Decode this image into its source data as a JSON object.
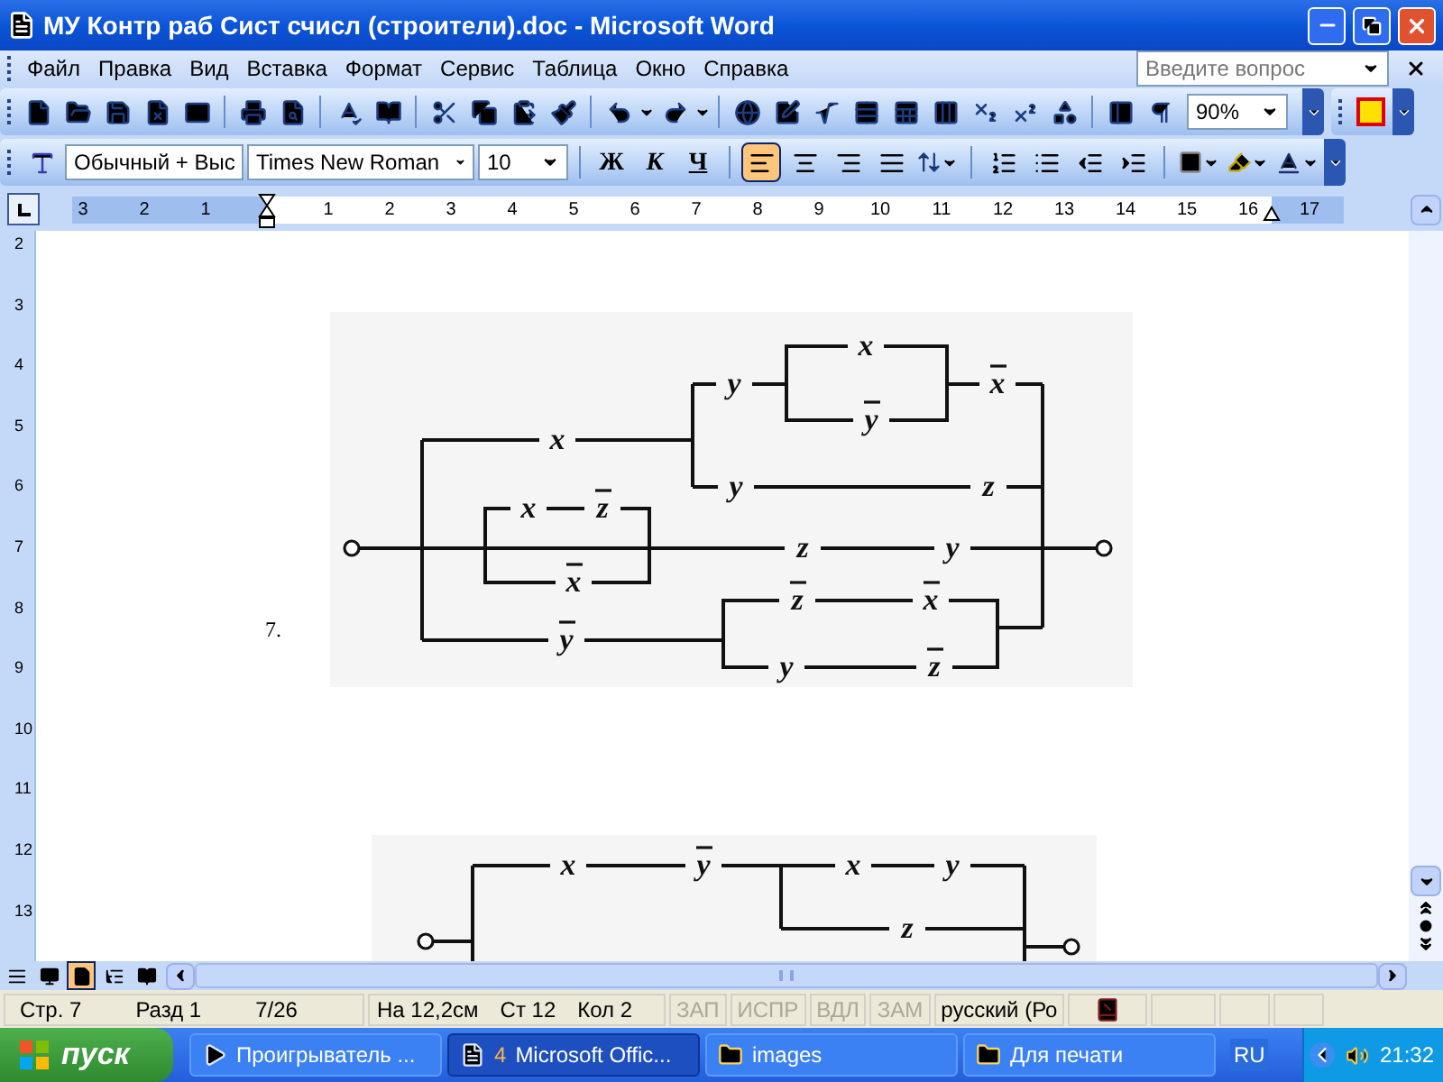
{
  "window": {
    "title": "МУ Контр раб Сист счисл (строители).doc - Microsoft Word"
  },
  "menu": [
    "Файл",
    "Правка",
    "Вид",
    "Вставка",
    "Формат",
    "Сервис",
    "Таблица",
    "Окно",
    "Справка"
  ],
  "help_search": {
    "placeholder": "Введите вопрос"
  },
  "zoom": "90%",
  "formatting": {
    "style": "Обычный + Выс",
    "font": "Times New Roman",
    "size": "10",
    "buttons": [
      "Ж",
      "К",
      "Ч"
    ],
    "alignment": [
      {
        "kind": "left",
        "selected": true
      },
      {
        "kind": "center",
        "selected": false
      },
      {
        "kind": "right",
        "selected": false
      },
      {
        "kind": "justify",
        "selected": false
      }
    ]
  },
  "ruler": {
    "left_numbers": [
      "3",
      "2",
      "1"
    ],
    "right_numbers": [
      "1",
      "2",
      "3",
      "4",
      "5",
      "6",
      "7",
      "8",
      "9",
      "10",
      "11",
      "12",
      "13",
      "14",
      "15",
      "16",
      "17"
    ]
  },
  "vertical_ruler": [
    "2",
    "3",
    "4",
    "5",
    "6",
    "7",
    "8",
    "9",
    "10",
    "11",
    "12",
    "13"
  ],
  "document": {
    "figures": [
      {
        "number": "7.",
        "labels": [
          {
            "text": "x",
            "negated": false
          },
          {
            "text": "y",
            "negated": false
          },
          {
            "text": "x",
            "negated": true
          },
          {
            "text": "y",
            "negated": true
          },
          {
            "text": "x",
            "negated": false
          },
          {
            "text": "y",
            "negated": false
          },
          {
            "text": "z",
            "negated": false
          },
          {
            "text": "x",
            "negated": false
          },
          {
            "text": "z",
            "negated": true
          },
          {
            "text": "z",
            "negated": false
          },
          {
            "text": "y",
            "negated": false
          },
          {
            "text": "x",
            "negated": true
          },
          {
            "text": "z",
            "negated": true
          },
          {
            "text": "x",
            "negated": true
          },
          {
            "text": "y",
            "negated": true
          },
          {
            "text": "y",
            "negated": false
          },
          {
            "text": "z",
            "negated": true
          }
        ]
      },
      {
        "labels": [
          {
            "text": "x",
            "negated": false
          },
          {
            "text": "y",
            "negated": true
          },
          {
            "text": "x",
            "negated": false
          },
          {
            "text": "y",
            "negated": false
          },
          {
            "text": "z",
            "negated": false
          }
        ]
      }
    ]
  },
  "view_modes": [
    {
      "kind": "normal",
      "selected": false
    },
    {
      "kind": "web",
      "selected": false
    },
    {
      "kind": "print",
      "selected": true
    },
    {
      "kind": "outline",
      "selected": false
    },
    {
      "kind": "reading",
      "selected": false
    }
  ],
  "status_bar": {
    "page": "Стр. 7",
    "section": "Разд 1",
    "pages": "7/26",
    "position": "На 12,2см",
    "line": "Ст 12",
    "column": "Кол 2",
    "indicators": [
      {
        "label": "ЗАП",
        "active": false
      },
      {
        "label": "ИСПР",
        "active": false
      },
      {
        "label": "ВДЛ",
        "active": false
      },
      {
        "label": "ЗАМ",
        "active": false
      }
    ],
    "language": "русский (Ро"
  },
  "taskbar": {
    "start": "пуск",
    "tasks": [
      {
        "kind": "media",
        "label": "Проигрыватель ...",
        "selected": false
      },
      {
        "kind": "word",
        "count": "4",
        "label": "Microsoft Offic...",
        "selected": true
      },
      {
        "kind": "folder",
        "label": "images",
        "selected": false
      },
      {
        "kind": "folder",
        "label": "Для печати",
        "selected": false
      }
    ],
    "language": "RU",
    "clock": "21:32"
  }
}
